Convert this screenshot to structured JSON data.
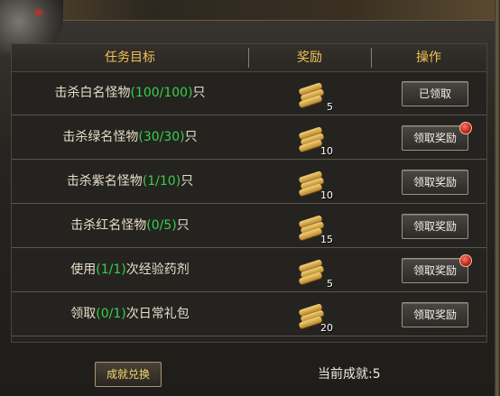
{
  "header": {
    "task_label": "任务目标",
    "reward_label": "奖励",
    "action_label": "操作"
  },
  "rows": [
    {
      "task_prefix": "击杀白名怪物",
      "task_progress": "(100/100)",
      "task_suffix": "只",
      "reward_count": "5",
      "button_label": "已领取",
      "has_alert": false
    },
    {
      "task_prefix": "击杀绿名怪物",
      "task_progress": "(30/30)",
      "task_suffix": "只",
      "reward_count": "10",
      "button_label": "领取奖励",
      "has_alert": true
    },
    {
      "task_prefix": "击杀紫名怪物",
      "task_progress": "(1/10)",
      "task_suffix": "只",
      "reward_count": "10",
      "button_label": "领取奖励",
      "has_alert": false
    },
    {
      "task_prefix": "击杀红名怪物",
      "task_progress": "(0/5)",
      "task_suffix": "只",
      "reward_count": "15",
      "button_label": "领取奖励",
      "has_alert": false
    },
    {
      "task_prefix": "使用",
      "task_progress": "(1/1)",
      "task_suffix": "次经验药剂",
      "reward_count": "5",
      "button_label": "领取奖励",
      "has_alert": true
    },
    {
      "task_prefix": "领取",
      "task_progress": "(0/1)",
      "task_suffix": "次日常礼包",
      "reward_count": "20",
      "button_label": "领取奖励",
      "has_alert": false
    }
  ],
  "footer": {
    "exchange_button": "成就兑换",
    "current_achievement": "当前成就:5"
  },
  "colors": {
    "header_text": "#f0c255",
    "progress_green": "#36d14a",
    "exchange_text": "#f3d86c"
  },
  "icons": {
    "reward": "scroll-bundle-icon",
    "alert": "red-dot-icon",
    "emblem": "dragon-emblem-icon"
  }
}
